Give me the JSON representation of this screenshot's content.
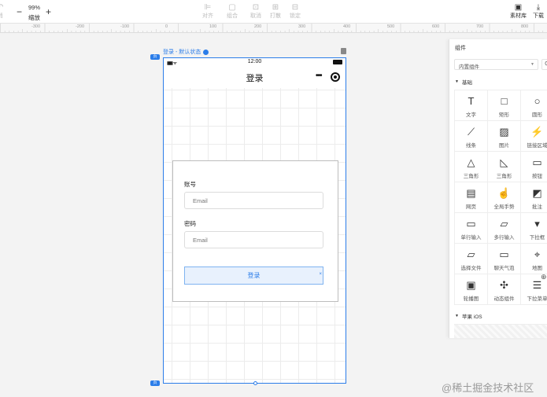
{
  "toolbar": {
    "left_partial": "消",
    "zoom_value": "99%",
    "zoom_label": "缩放",
    "zoom_out": "−",
    "zoom_in": "+",
    "align": "对齐",
    "group": "组合",
    "ungroup": "取消",
    "bundle": "打散",
    "lock": "锁定",
    "assets": "素材库",
    "download": "下载"
  },
  "ruler": {
    "labels": [
      "-300",
      "-200",
      "-100",
      "0",
      "100",
      "200",
      "300",
      "400",
      "500",
      "600",
      "700",
      "800"
    ]
  },
  "frame": {
    "label": "登录 - 默认状态",
    "badge_top": "页",
    "badge_bottom": "页"
  },
  "phone": {
    "time": "12:00",
    "signal": "▮▮▮ ᯤ",
    "nav_title": "登录",
    "more": "•••"
  },
  "login_form": {
    "account_label": "账号",
    "account_placeholder": "Email",
    "password_label": "密码",
    "password_placeholder": "Email",
    "submit_label": "登录",
    "selected_marker": "×"
  },
  "panel": {
    "title": "组件",
    "select_value": "内置组件",
    "search_icon": "Q",
    "section_basic": "基础",
    "section_ios": "苹果 iOS",
    "components": [
      {
        "glyph": "T",
        "label": "文字",
        "name": "text-icon"
      },
      {
        "glyph": "□",
        "label": "矩形",
        "name": "rectangle-icon"
      },
      {
        "glyph": "○",
        "label": "圆形",
        "name": "circle-icon"
      },
      {
        "glyph": "⟋",
        "label": "线条",
        "name": "line-icon"
      },
      {
        "glyph": "▨",
        "label": "图片",
        "name": "image-icon"
      },
      {
        "glyph": "⚡",
        "label": "链接区域",
        "name": "link-area-icon"
      },
      {
        "glyph": "△",
        "label": "三角形",
        "name": "triangle-icon"
      },
      {
        "glyph": "◺",
        "label": "三角形",
        "name": "right-triangle-icon"
      },
      {
        "glyph": "▭",
        "label": "按钮",
        "name": "button-icon"
      },
      {
        "glyph": "▤",
        "label": "网页",
        "name": "webpage-icon"
      },
      {
        "glyph": "☝",
        "label": "全局手势",
        "name": "gesture-icon"
      },
      {
        "glyph": "◩",
        "label": "批注",
        "name": "annotation-icon"
      },
      {
        "glyph": "▭",
        "label": "单行输入",
        "name": "single-input-icon"
      },
      {
        "glyph": "▱",
        "label": "多行输入",
        "name": "multi-input-icon"
      },
      {
        "glyph": "▾",
        "label": "下拉框",
        "name": "dropdown-icon"
      },
      {
        "glyph": "▱",
        "label": "选择文件",
        "name": "file-select-icon"
      },
      {
        "glyph": "▭",
        "label": "聊天气泡",
        "name": "chat-bubble-icon"
      },
      {
        "glyph": "⌖",
        "label": "地图",
        "name": "map-icon"
      },
      {
        "glyph": "▣",
        "label": "轮播图",
        "name": "carousel-icon"
      },
      {
        "glyph": "✣",
        "label": "动态组件",
        "name": "dynamic-component-icon"
      },
      {
        "glyph": "☰",
        "label": "下拉菜单",
        "name": "dropdown-menu-icon"
      }
    ]
  },
  "watermark": "@稀土掘金技术社区"
}
